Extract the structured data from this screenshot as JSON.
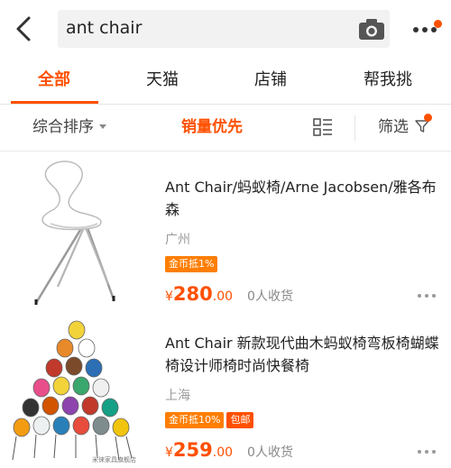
{
  "search": {
    "query": "ant chair"
  },
  "tabs": [
    "全部",
    "天猫",
    "店铺",
    "帮我挑"
  ],
  "sort": {
    "overall": "综合排序",
    "sales": "销量优先",
    "filter": "筛选"
  },
  "icons": {
    "back": "back-chevron-icon",
    "camera": "camera-icon",
    "more": "more-dots-icon",
    "layout": "list-layout-icon",
    "filter": "filter-funnel-icon"
  },
  "colors": {
    "accent": "#ff5000",
    "coin_badge": "#ff7e00"
  },
  "items": [
    {
      "title": "Ant Chair/蚂蚁椅/Arne Jacobsen/雅各布森",
      "location": "广州",
      "badges": [
        "金币抵1%"
      ],
      "currency": "¥",
      "price_int": "280",
      "price_dec": ".00",
      "sold": "0人收货"
    },
    {
      "title": "Ant Chair 新款现代曲木蚂蚁椅弯板椅蝴蝶椅设计师椅时尚快餐椅",
      "location": "上海",
      "badges": [
        "金币抵10%",
        "包邮"
      ],
      "currency": "¥",
      "price_int": "259",
      "price_dec": ".00",
      "sold": "0人收货",
      "watermark": "米徕家具旗舰店"
    }
  ]
}
